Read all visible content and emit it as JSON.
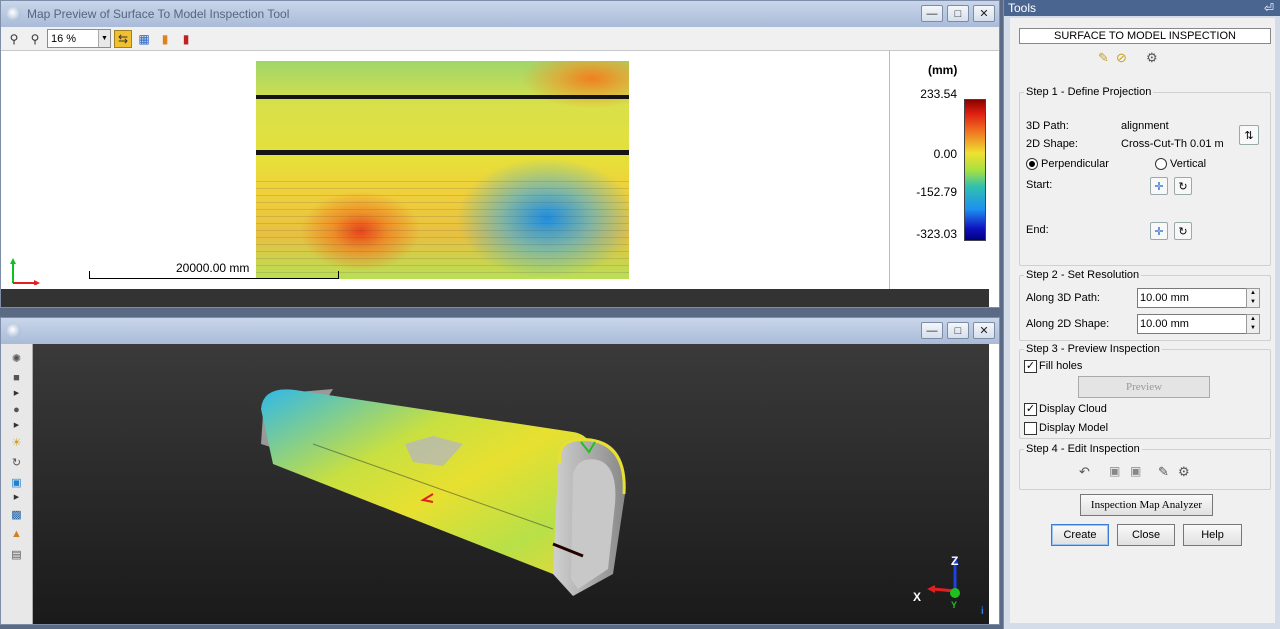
{
  "map_window": {
    "title": "Map Preview of Surface To Model Inspection Tool",
    "zoom_value": "16 %",
    "scale_label": "20000.00 mm",
    "legend": {
      "unit": "(mm)",
      "values": [
        "233.54",
        "0.00",
        "-152.79",
        "-323.03"
      ]
    }
  },
  "view3d_window": {
    "axis_labels": {
      "z": "Z",
      "x": "X",
      "y": "Y"
    }
  },
  "tools": {
    "header": "Tools",
    "pin": "⌂",
    "panel_title": "SURFACE TO MODEL INSPECTION",
    "step1": {
      "title": "Step 1 - Define Projection",
      "path_label": "3D Path:",
      "path_value": "alignment",
      "shape_label": "2D Shape:",
      "shape_value": "Cross-Cut-Th 0.01 m",
      "perpendicular": "Perpendicular",
      "vertical": "Vertical",
      "start": "Start:",
      "end": "End:"
    },
    "step2": {
      "title": "Step 2 - Set Resolution",
      "along_path_label": "Along 3D Path:",
      "along_path_value": "10.00 mm",
      "along_shape_label": "Along 2D Shape:",
      "along_shape_value": "10.00 mm"
    },
    "step3": {
      "title": "Step 3 - Preview Inspection",
      "fill_holes": "Fill holes",
      "preview": "Preview",
      "display_cloud": "Display Cloud",
      "display_model": "Display Model"
    },
    "step4": {
      "title": "Step 4 - Edit Inspection"
    },
    "analyzer": "Inspection Map Analyzer",
    "create": "Create",
    "close": "Close",
    "help": "Help"
  }
}
